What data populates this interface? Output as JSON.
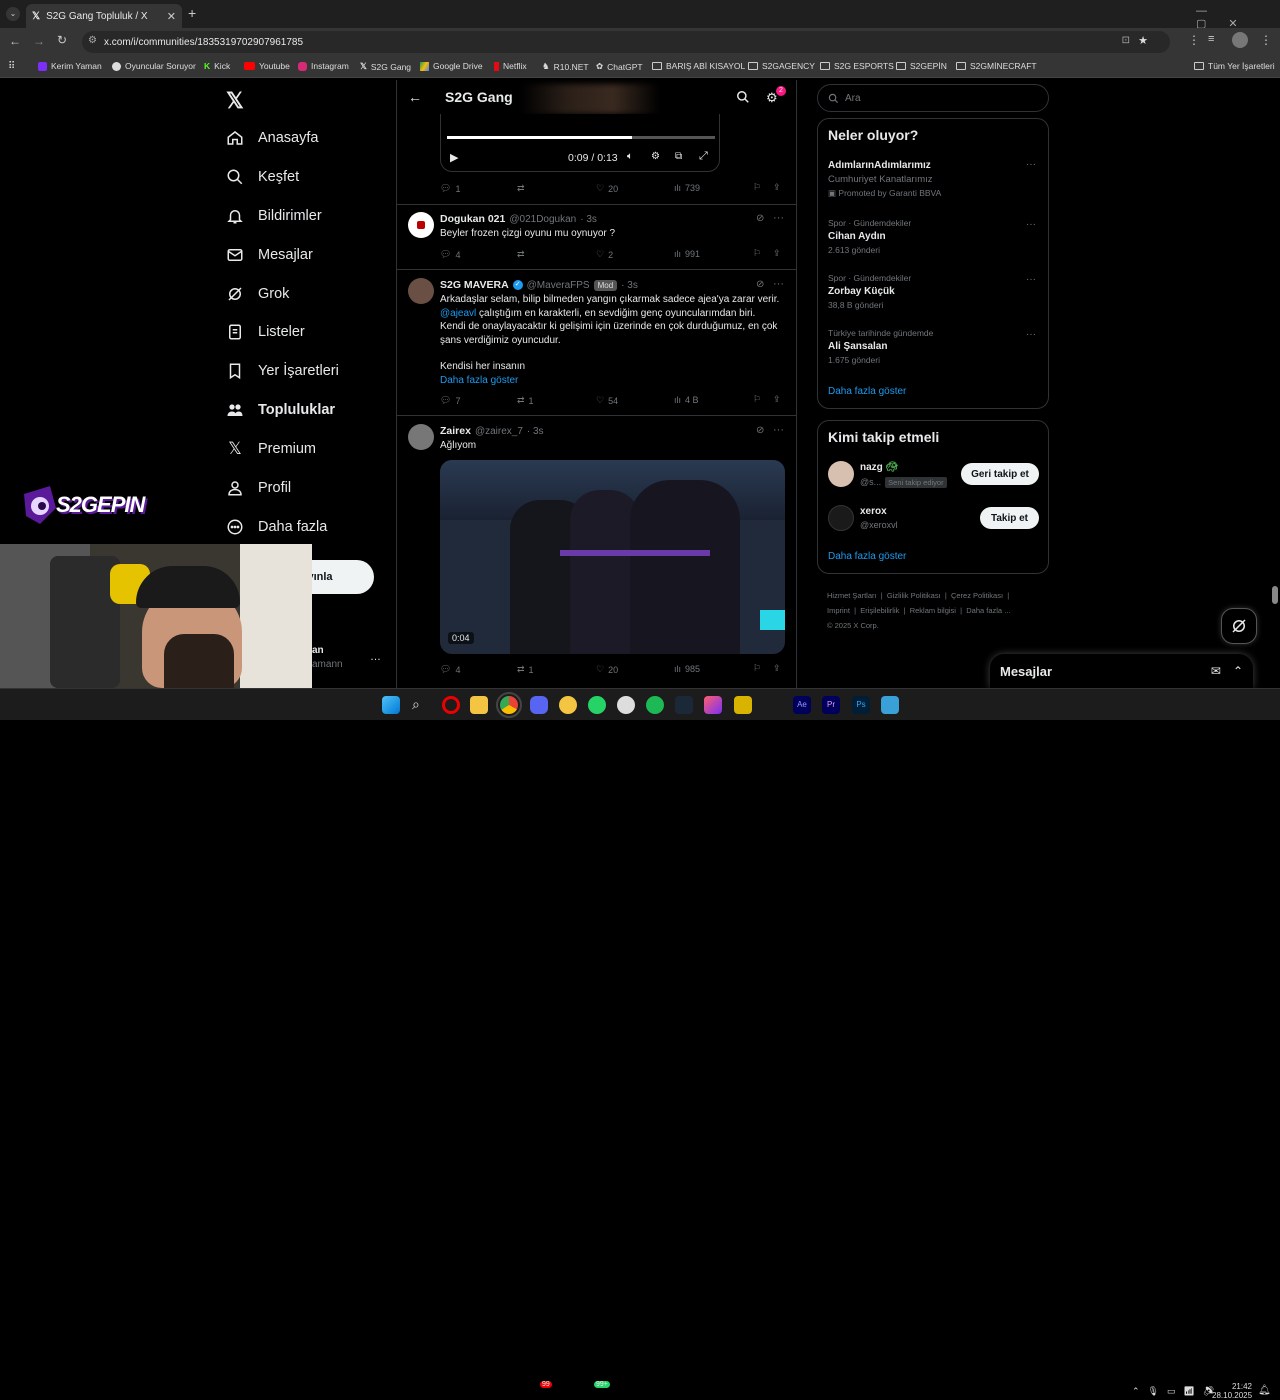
{
  "browser": {
    "tab_title": "S2G Gang Topluluk / X",
    "url": "x.com/i/communities/1835319702907961785",
    "bookmarks": [
      "Kerim Yaman",
      "Oyuncular Soruyor",
      "Kick",
      "Youtube",
      "Instagram",
      "S2G Gang",
      "Google Drive",
      "Netflix",
      "R10.NET",
      "ChatGPT",
      "BARIŞ ABİ KISAYOL",
      "S2GAGENCY",
      "S2G ESPORTS",
      "S2GEPİN",
      "S2GMİNECRAFT"
    ],
    "all_bookmarks": "Tüm Yer İşaretleri"
  },
  "nav": {
    "items": [
      "Anasayfa",
      "Keşfet",
      "Bildirimler",
      "Mesajlar",
      "Grok",
      "Listeler",
      "Yer İşaretleri",
      "Topluluklar",
      "Premium",
      "Profil",
      "Daha fazla"
    ],
    "post_partial": "yınla",
    "user_partial_name": "an",
    "user_partial_handle": "amann",
    "more_dots": "…"
  },
  "community": {
    "title": "S2G Gang",
    "settings_badge": "2"
  },
  "video1": {
    "time": "0:09 / 0:13",
    "progress": 0.69
  },
  "post0": {
    "replies": "1",
    "reposts": "",
    "likes": "20",
    "views": "739"
  },
  "post1": {
    "name": "Dogukan 021",
    "handle": "@021Dogukan",
    "time": "· 3s",
    "text": "Beyler frozen çizgi oyunu mu oynuyor ?",
    "replies": "4",
    "reposts": "",
    "likes": "2",
    "views": "991"
  },
  "post2": {
    "name": "S2G MAVERA",
    "handle": "@MaveraFPS",
    "badge": "Mod",
    "time": "· 3s",
    "line1": "Arkadaşlar selam, bilip bilmeden yangın çıkarmak sadece ajea'ya zarar verir.",
    "mention": "@ajeavl",
    "line2": " çalıştığım en karakterli, en sevdiğim genç oyuncularımdan biri.",
    "line3": "Kendi de onaylayacaktır ki gelişimi için üzerinde en çok durduğumuz, en çok",
    "line4": "şans verdiğimiz oyuncudur.",
    "line5": "Kendisi her insanın",
    "show_more": "Daha fazla göster",
    "replies": "7",
    "reposts": "1",
    "likes": "54",
    "views": "4 B"
  },
  "post3": {
    "name": "Zairex",
    "handle": "@zairex_7",
    "time": "· 3s",
    "text": "Ağlıyom",
    "video_time": "0:04",
    "replies": "4",
    "reposts": "1",
    "likes": "20",
    "views": "985"
  },
  "search": {
    "placeholder": "Ara"
  },
  "trends": {
    "heading": "Neler oluyor?",
    "items": [
      {
        "title": "AdımlarınAdımlarımız",
        "sub": "Cumhuriyet Kanatlarımız",
        "promo": "Promoted by Garanti BBVA"
      },
      {
        "cat": "Spor · Gündemdekiler",
        "title": "Cihan Aydın",
        "count": "2.613 gönderi"
      },
      {
        "cat": "Spor · Gündemdekiler",
        "title": "Zorbay Küçük",
        "count": "38,8 B gönderi"
      },
      {
        "cat": "Türkiye tarihinde gündemde",
        "title": "Ali Şansalan",
        "count": "1.675 gönderi"
      }
    ],
    "show_more": "Daha fazla göster"
  },
  "follow": {
    "heading": "Kimi takip etmeli",
    "users": [
      {
        "name": "nazg",
        "handle": "@s...",
        "follows_you": "Seni takip ediyor",
        "button": "Geri takip et"
      },
      {
        "name": "xerox",
        "handle": "@xeroxvl",
        "button": "Takip et"
      }
    ],
    "show_more": "Daha fazla göster"
  },
  "footer": {
    "links": [
      "Hizmet Şartları",
      "Gizlilik Politikası",
      "Çerez Politikası",
      "Imprint",
      "Erişilebilirlik",
      "Reklam bilgisi",
      "Daha fazla ..."
    ],
    "copyright": "© 2025 X Corp."
  },
  "messages": {
    "label": "Mesajlar"
  },
  "overlay": {
    "logo_text": "S2GEPIN"
  },
  "taskbar": {
    "time": "21:42",
    "date": "28.10.2025",
    "discord_badge": "99",
    "whatsapp_badge": "99+"
  }
}
